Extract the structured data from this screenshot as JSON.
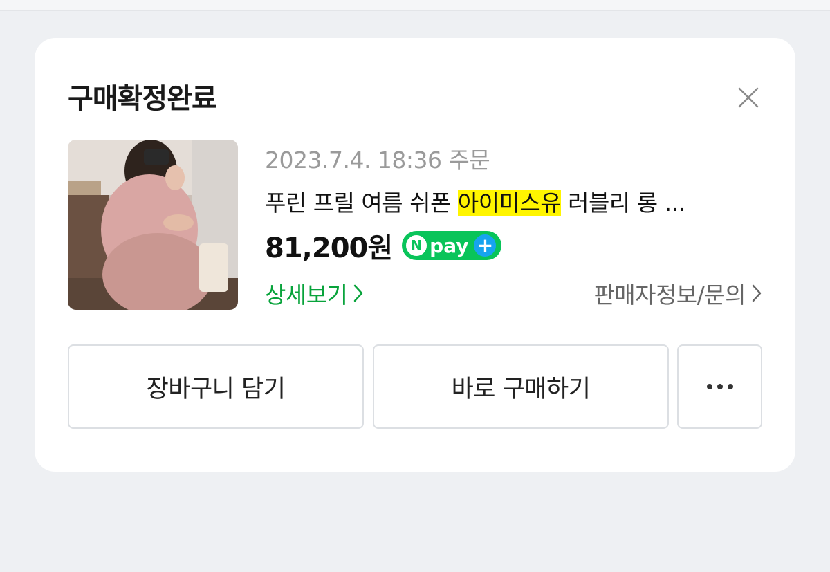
{
  "card": {
    "title": "구매확정완료",
    "close_icon": "close-icon"
  },
  "order": {
    "date": "2023.7.4. 18:36 주문",
    "product_name_prefix": "푸린 프릴 여름 쉬폰 ",
    "product_name_highlight": "아이미스유",
    "product_name_suffix": " 러블리 롱 ...",
    "price": "81,200원",
    "pay_badge": {
      "n": "N",
      "label": "pay",
      "plus": "+",
      "color": "#09c45a"
    },
    "detail_link": "상세보기",
    "seller_link": "판매자정보/문의"
  },
  "actions": {
    "cart": "장바구니 담기",
    "buy_now": "바로 구매하기",
    "more_icon": "more-horizontal-icon"
  },
  "colors": {
    "accent_green": "#08a33b",
    "highlight": "#fff500",
    "npay_plus": "#17a4ef"
  }
}
